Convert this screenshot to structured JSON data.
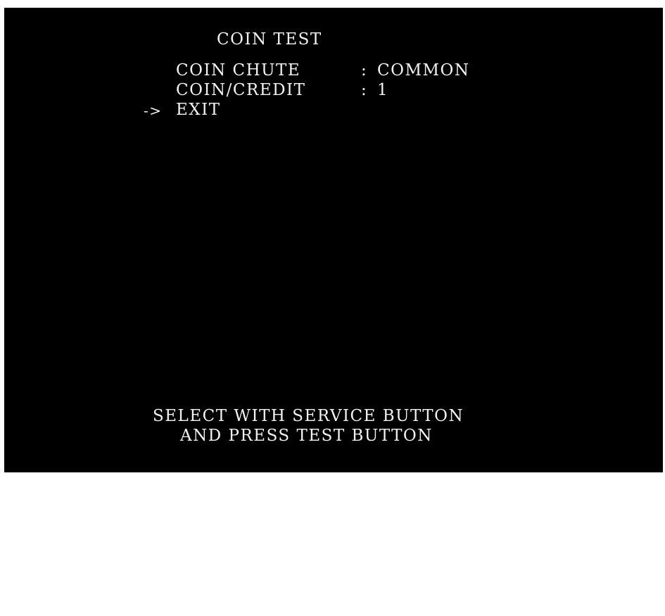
{
  "screen": {
    "title": "COIN TEST",
    "menu": [
      {
        "label": "COIN CHUTE",
        "separator": ":",
        "value": "COMMON"
      },
      {
        "label": "COIN/CREDIT",
        "separator": ":",
        "value": "1"
      },
      {
        "label": "EXIT"
      }
    ],
    "cursor": "->",
    "selected_index": 2,
    "footer": {
      "line1": "SELECT WITH SERVICE BUTTON",
      "line2": "AND PRESS TEST BUTTON"
    }
  },
  "colors": {
    "background": "#000000",
    "text": "#f2f2f2"
  }
}
